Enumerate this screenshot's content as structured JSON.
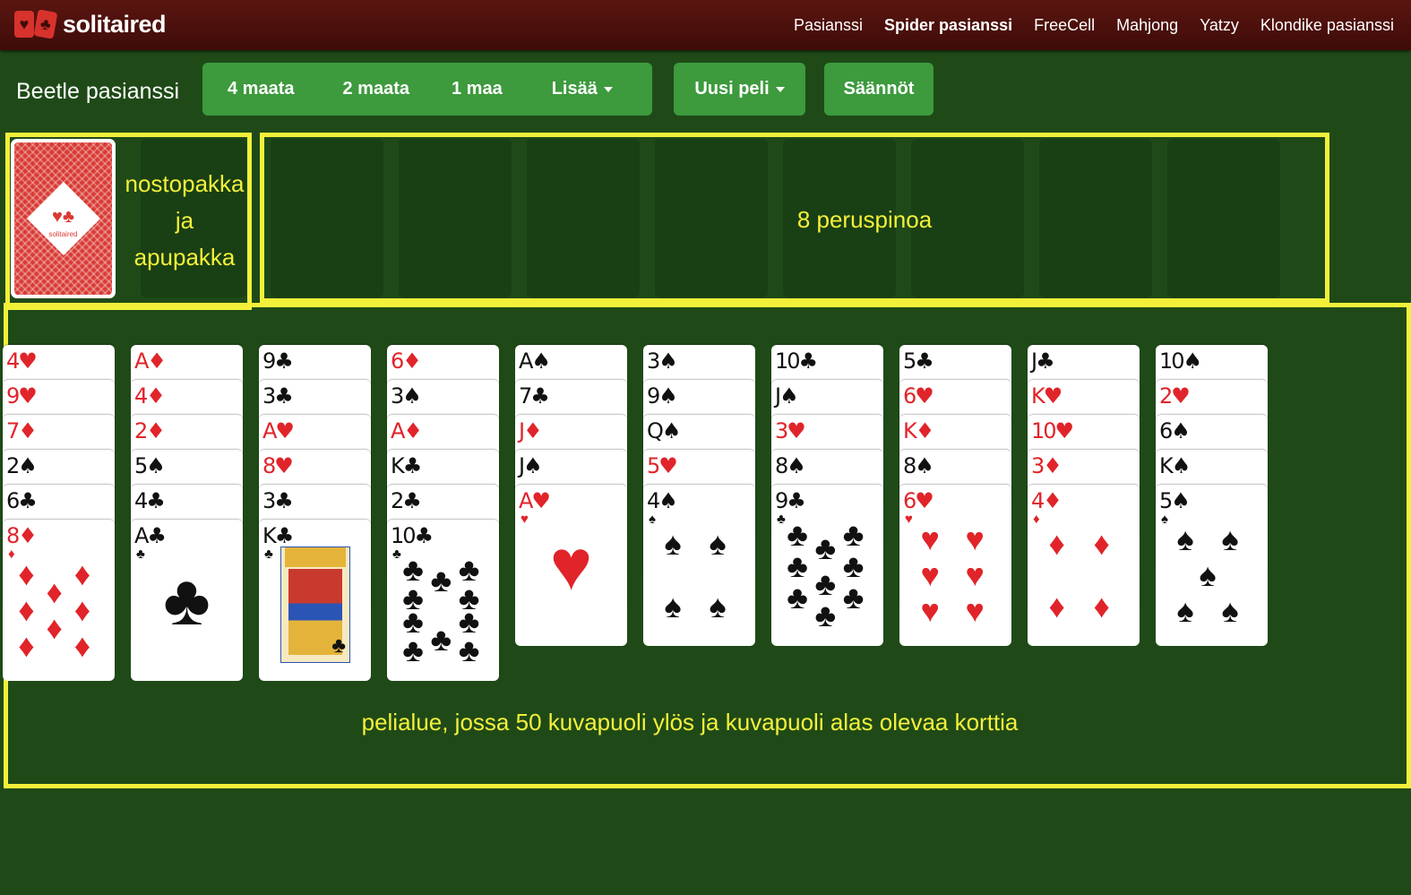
{
  "brand": {
    "name": "solitaired",
    "mark_suits": [
      "♥",
      "♣"
    ]
  },
  "nav": {
    "items": [
      {
        "label": "Pasianssi",
        "active": false
      },
      {
        "label": "Spider pasianssi",
        "active": true
      },
      {
        "label": "FreeCell",
        "active": false
      },
      {
        "label": "Mahjong",
        "active": false
      },
      {
        "label": "Yatzy",
        "active": false
      },
      {
        "label": "Klondike pasianssi",
        "active": false
      }
    ]
  },
  "toolbar": {
    "game_title": "Beetle pasianssi",
    "suits": {
      "four": "4 maata",
      "two": "2 maata",
      "one": "1 maa",
      "more": "Lisää"
    },
    "new_game": "Uusi peli",
    "rules": "Säännöt"
  },
  "stock": {
    "emblem": "♥♣",
    "emblem_text": "solitaired"
  },
  "annotations": {
    "stock_lines": [
      "nostopakka",
      "ja",
      "apupakka"
    ],
    "foundations": "8 peruspinoa",
    "tableau": "pelialue, jossa 50 kuvapuoli ylös ja kuvapuoli alas olevaa korttia"
  },
  "colors": {
    "felt": "#1f4a18",
    "button": "#3d9a3d",
    "highlight": "#f3f03a",
    "header": "#4a100b"
  },
  "tableau": [
    [
      "4♥",
      "9♥",
      "7♦",
      "2♠",
      "6♣",
      "8♦"
    ],
    [
      "A♦",
      "4♦",
      "2♦",
      "5♠",
      "4♣",
      "A♣"
    ],
    [
      "9♣",
      "3♣",
      "A♥",
      "8♥",
      "3♣",
      "K♣"
    ],
    [
      "6♦",
      "3♠",
      "A♦",
      "K♣",
      "2♣",
      "10♣"
    ],
    [
      "A♠",
      "7♣",
      "J♦",
      "J♠",
      "A♥"
    ],
    [
      "3♠",
      "9♠",
      "Q♠",
      "5♥",
      "4♠"
    ],
    [
      "10♣",
      "J♠",
      "3♥",
      "8♠",
      "9♣"
    ],
    [
      "5♣",
      "6♥",
      "K♦",
      "8♠",
      "6♥"
    ],
    [
      "J♣",
      "K♥",
      "10♥",
      "3♦",
      "4♦"
    ],
    [
      "10♠",
      "2♥",
      "6♠",
      "K♠",
      "5♠"
    ]
  ]
}
